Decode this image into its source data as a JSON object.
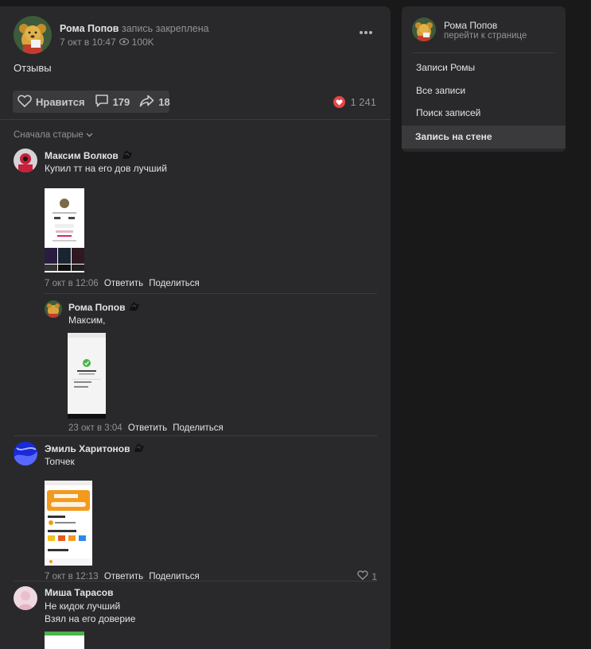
{
  "post": {
    "author": "Рома Попов",
    "pinned_label": "запись закреплена",
    "date": "7 окт в 10:47",
    "views": "100K",
    "text": "Отзывы",
    "actions": {
      "like_label": "Нравится",
      "comments_count": "179",
      "shares_count": "18",
      "likes_total": "1 241"
    },
    "sort_label": "Сначала старые"
  },
  "comments": [
    {
      "author": "Максим Волков",
      "text": "Купил тт на его дов лучший",
      "date": "7 окт в 12:06",
      "reply": "Ответить",
      "share": "Поделиться"
    },
    {
      "author": "Рома Попов",
      "text": "Максим,",
      "date": "23 окт в 3:04",
      "reply": "Ответить",
      "share": "Поделиться"
    },
    {
      "author": "Эмиль Харитонов",
      "text": "Топчек",
      "date": "7 окт в 12:13",
      "reply": "Ответить",
      "share": "Поделиться",
      "likes": "1"
    },
    {
      "author": "Миша Тарасов",
      "text_line1": "Не кидок лучший",
      "text_line2": "Взял на его доверие"
    }
  ],
  "sidebar": {
    "name": "Рома Попов",
    "subtitle": "перейти к странице",
    "items": [
      {
        "label": "Записи Ромы"
      },
      {
        "label": "Все записи"
      },
      {
        "label": "Поиск записей"
      },
      {
        "label": "Запись на стене"
      }
    ]
  },
  "colors": {
    "background": "#19191a",
    "card": "#29292b",
    "accent_red": "#e64646",
    "muted_text": "#939393"
  }
}
